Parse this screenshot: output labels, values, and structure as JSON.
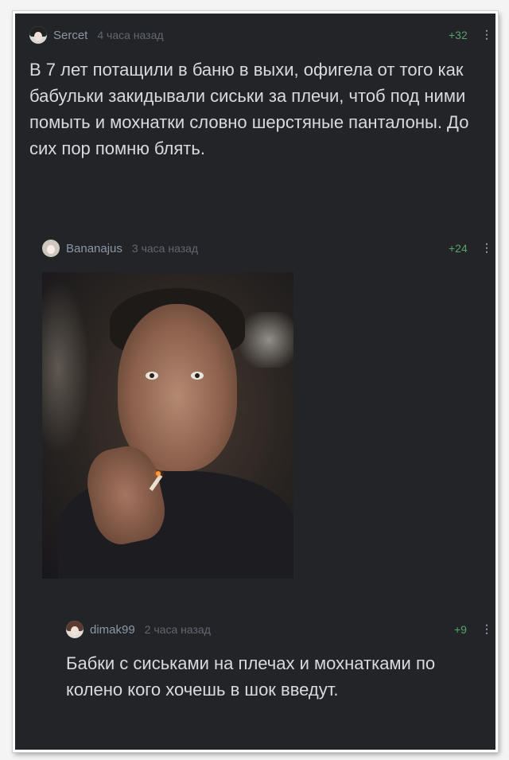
{
  "comments": [
    {
      "username": "Sercet",
      "time": "4 часа назад",
      "score": "+32",
      "more": "⋮",
      "text": "В 7 лет потащили в баню в выхи, офигела от того как бабульки закидывали сиськи за плечи, чтоб под ними помыть и мохнатки словно шерстяные панталоны. До сих пор помню блять."
    },
    {
      "username": "Bananajus",
      "time": "3 часа назад",
      "score": "+24",
      "more": "⋮"
    },
    {
      "username": "dimak99",
      "time": "2 часа назад",
      "score": "+9",
      "more": "⋮",
      "text": "Бабки с сиськами на плечах и мохнатками по колено кого хочешь в шок введут."
    }
  ],
  "icons": {
    "avatar": "avatar-icon",
    "more": "more-vertical-icon"
  },
  "colors": {
    "background": "#232427",
    "username": "#8c96a5",
    "time": "#616770",
    "score": "#57a36a",
    "text": "#d8dadd"
  }
}
